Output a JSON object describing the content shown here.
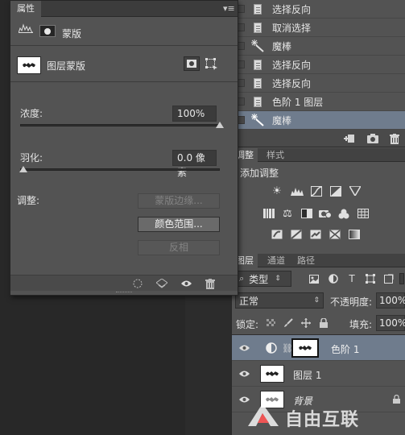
{
  "history": {
    "items": [
      {
        "label": "选择反向",
        "icon": "document-icon",
        "selected": false
      },
      {
        "label": "取消选择",
        "icon": "document-icon",
        "selected": false
      },
      {
        "label": "魔棒",
        "icon": "magic-wand-icon",
        "selected": false
      },
      {
        "label": "选择反向",
        "icon": "document-icon",
        "selected": false
      },
      {
        "label": "选择反向",
        "icon": "document-icon",
        "selected": false
      },
      {
        "label": "色阶 1 图层",
        "icon": "document-icon",
        "selected": false
      },
      {
        "label": "魔棒",
        "icon": "magic-wand-icon",
        "selected": true
      }
    ]
  },
  "adjust_panel": {
    "tabs": [
      "调整",
      "样式"
    ],
    "heading": "添加调整"
  },
  "layers_panel": {
    "tabs": [
      "图层",
      "通道",
      "路径"
    ],
    "filter_kind": "类型",
    "blend_mode": "正常",
    "opacity_label": "不透明度:",
    "opacity_value": "100%",
    "lock_label": "锁定:",
    "fill_label": "填充:",
    "fill_value": "100%",
    "layers": [
      {
        "name": "色阶 1",
        "selected": true
      },
      {
        "name": "图层 1",
        "selected": false
      },
      {
        "name": "背景",
        "selected": false
      }
    ]
  },
  "properties": {
    "tab": "属性",
    "mode_label": "蒙版",
    "mask_type": "图层蒙版",
    "density_label": "浓度:",
    "density_value": "100%",
    "density_level": 1.0,
    "feather_label": "羽化:",
    "feather_value": "0.0 像素",
    "feather_level": 0.0,
    "refine_label": "调整:",
    "btn_mask_edge": "蒙版边缘...",
    "btn_color_range": "颜色范围...",
    "btn_invert": "反相"
  },
  "watermark": "自由互联",
  "colors": {
    "selection": "#6f7c8d",
    "panel": "#535353"
  }
}
